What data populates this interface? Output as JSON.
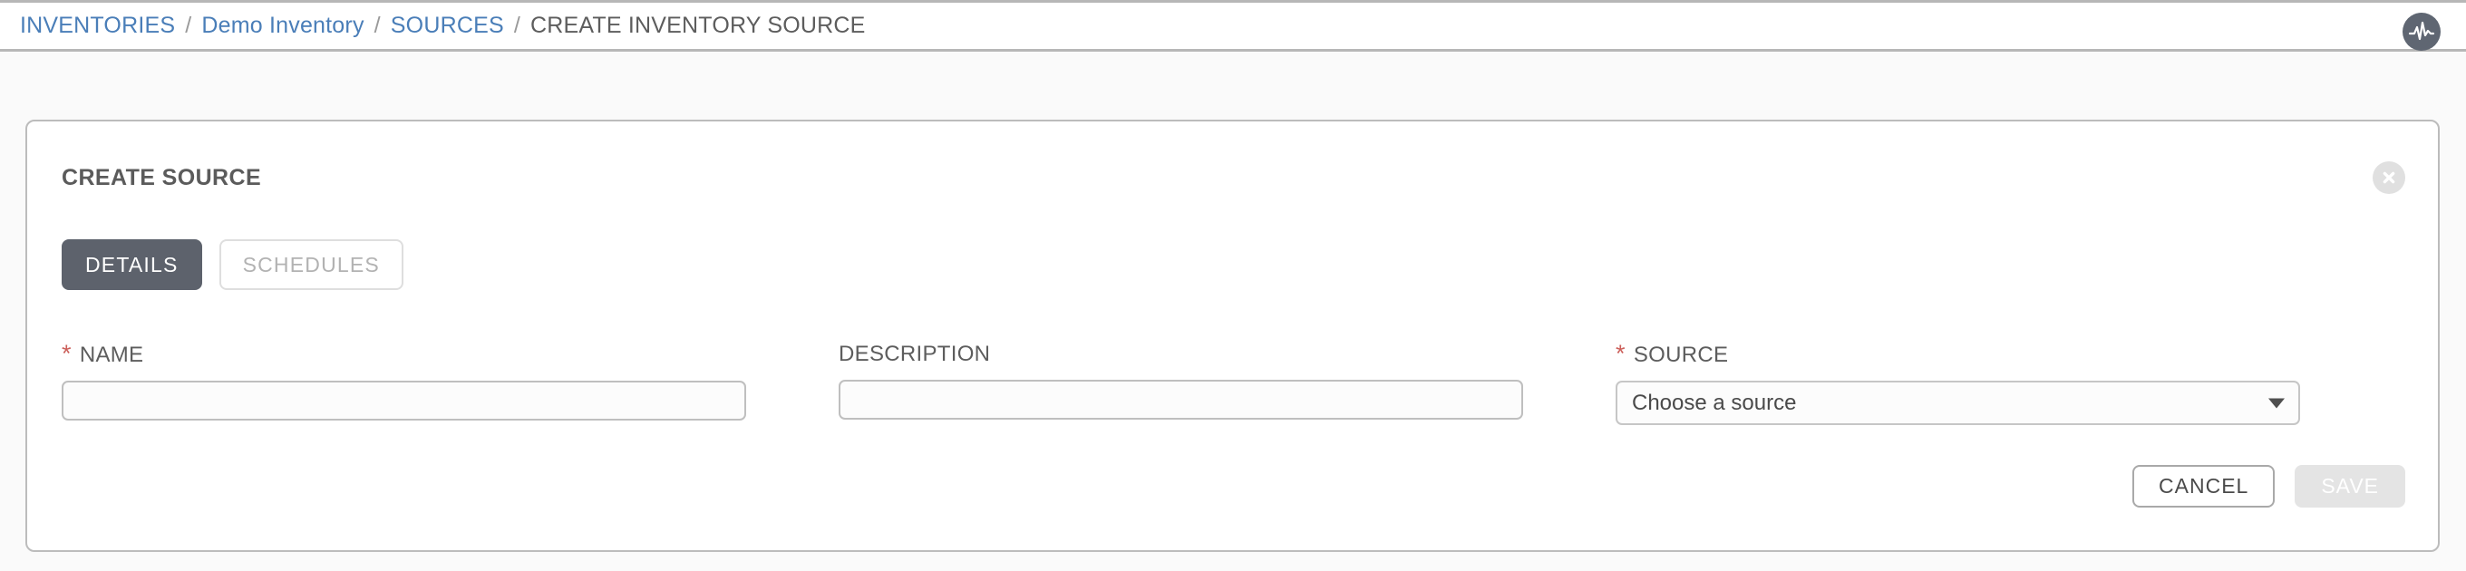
{
  "header": {
    "breadcrumb": [
      {
        "label": "INVENTORIES",
        "type": "link"
      },
      {
        "label": "Demo Inventory",
        "type": "link"
      },
      {
        "label": "SOURCES",
        "type": "link"
      },
      {
        "label": "CREATE INVENTORY SOURCE",
        "type": "current"
      }
    ],
    "separator": "/",
    "logo_icon": "pulse-logo-icon"
  },
  "panel": {
    "title": "CREATE SOURCE",
    "close_icon": "close-circle-icon",
    "tabs": [
      {
        "label": "DETAILS",
        "active": true
      },
      {
        "label": "SCHEDULES",
        "active": false
      }
    ],
    "fields": {
      "name": {
        "label": "NAME",
        "required": true,
        "star": "*",
        "value": "",
        "placeholder": ""
      },
      "description": {
        "label": "DESCRIPTION",
        "required": false,
        "value": "",
        "placeholder": ""
      },
      "source": {
        "label": "SOURCE",
        "required": true,
        "star": "*",
        "value": "Choose a source",
        "caret_icon": "chevron-down-icon"
      }
    },
    "actions": {
      "cancel_label": "CANCEL",
      "save_label": "SAVE"
    }
  },
  "colors": {
    "link": "#4a7eb8",
    "required": "#cc5f5a",
    "tab_active_bg": "#5d626c",
    "logo_bg": "#5f6672",
    "page_bg": "#fafafa"
  }
}
